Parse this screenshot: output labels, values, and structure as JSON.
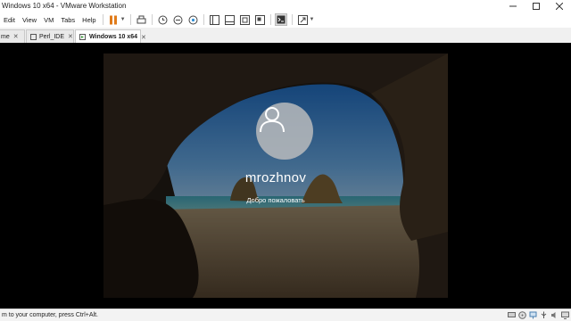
{
  "window": {
    "title": "Windows 10 x64 - VMware Workstation",
    "controls": {
      "minimize_icon": "minimize-icon",
      "maximize_icon": "maximize-icon",
      "close_icon": "close-icon"
    }
  },
  "menu": {
    "items": [
      "Edit",
      "View",
      "VM",
      "Tabs",
      "Help"
    ]
  },
  "toolbar": {
    "pause_color": "#e07b1a",
    "icons": [
      "pause-icon",
      "send-ctrl-alt-del-icon",
      "snapshot-icon",
      "revert-snapshot-icon",
      "snapshot-manager-icon",
      "library-icon",
      "thumbnail-icon",
      "fullscreen-icon",
      "unity-icon",
      "console-view-icon",
      "stretch-guest-icon"
    ]
  },
  "tabs": [
    {
      "label": "me",
      "active": false
    },
    {
      "label": "Perl_IDE",
      "active": false
    },
    {
      "label": "Windows 10 x64",
      "active": true
    }
  ],
  "guest": {
    "username": "mrozhnov",
    "welcome_text": "Добро пожаловать"
  },
  "status": {
    "text": "m to your computer, press Ctrl+Alt.",
    "icons": [
      "hard-disk-icon",
      "cd-dvd-icon",
      "network-icon",
      "usb-icon",
      "sound-icon",
      "display-icon"
    ]
  }
}
